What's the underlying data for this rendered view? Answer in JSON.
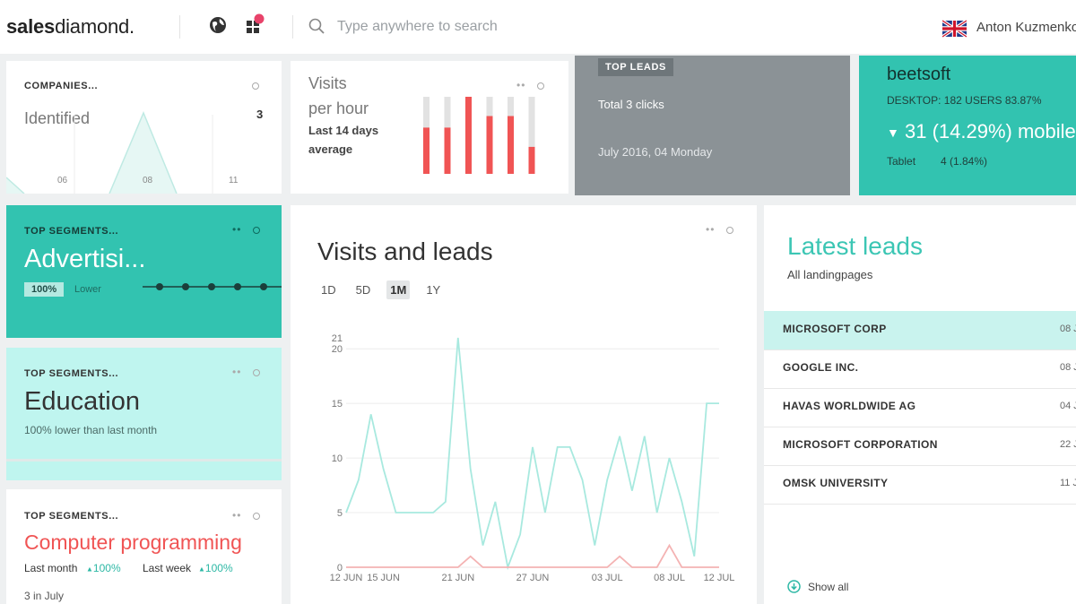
{
  "header": {
    "logo_bold": "sales",
    "logo_regular": "diamond.",
    "search_placeholder": "Type anywhere to search",
    "user_name": "Anton Kuzmenko"
  },
  "companies": {
    "title": "COMPANIES...",
    "label": "Identified",
    "count": "3",
    "ticks": [
      "06",
      "08",
      "11"
    ]
  },
  "visits_per_hour": {
    "title_line1": "Visits",
    "title_line2": "per hour",
    "subtitle_line1": "Last 14 days",
    "subtitle_line2": "average",
    "bars": [
      0.6,
      0.6,
      1.0,
      0.75,
      0.75,
      0.35
    ],
    "bar_color": "#f05454",
    "track_color": "#e2e2e2"
  },
  "top_leads": {
    "badge": "TOP LEADS",
    "clicks": "Total 3 clicks",
    "date": "July 2016, 04 Monday"
  },
  "beetsoft": {
    "name": "beetsoft",
    "desktop": "DESKTOP: 182 USERS 83.87%",
    "mobile": "31 (14.29%) mobile",
    "tablet_label": "Tablet",
    "tablet_value": "4 (1.84%)"
  },
  "segment_advertising": {
    "title": "TOP SEGMENTS...",
    "name": "Advertisi...",
    "badge": "100%",
    "sub": "Lower"
  },
  "segment_education": {
    "title": "TOP SEGMENTS...",
    "name": "Education",
    "sub": "100% lower than last month"
  },
  "segment_programming": {
    "title": "TOP SEGMENTS...",
    "name": "Computer programming",
    "last_month_label": "Last month",
    "last_month_value": "100%",
    "last_week_label": "Last week",
    "last_week_value": "100%",
    "footer": "3 in July"
  },
  "visits_leads": {
    "title": "Visits and leads",
    "timeframes": [
      "1D",
      "5D",
      "1M",
      "1Y"
    ],
    "active_timeframe": "1M"
  },
  "chart_data": {
    "type": "line",
    "y_ticks": [
      0,
      5,
      10,
      15,
      20,
      21
    ],
    "ylim": [
      0,
      21
    ],
    "x_tick_labels": [
      "12 JUN",
      "15 JUN",
      "21 JUN",
      "27 JUN",
      "03 JUL",
      "08 JUL",
      "12 JUL"
    ],
    "x_tick_index": [
      0,
      3,
      9,
      15,
      21,
      26,
      30
    ],
    "x": [
      "12 JUN",
      "13 JUN",
      "14 JUN",
      "15 JUN",
      "16 JUN",
      "17 JUN",
      "18 JUN",
      "19 JUN",
      "20 JUN",
      "21 JUN",
      "22 JUN",
      "23 JUN",
      "24 JUN",
      "25 JUN",
      "26 JUN",
      "27 JUN",
      "28 JUN",
      "29 JUN",
      "30 JUN",
      "01 JUL",
      "02 JUL",
      "03 JUL",
      "04 JUL",
      "05 JUL",
      "06 JUL",
      "07 JUL",
      "08 JUL",
      "09 JUL",
      "10 JUL",
      "11 JUL",
      "12 JUL"
    ],
    "series": [
      {
        "values": [
          5,
          8,
          14,
          9,
          5,
          5,
          5,
          5,
          6,
          21,
          9,
          2,
          6,
          0,
          3,
          11,
          5,
          11,
          11,
          8,
          2,
          8,
          12,
          7,
          12,
          5,
          10,
          6,
          1,
          15,
          15
        ],
        "color": "#a8e9df"
      },
      {
        "values": [
          0,
          0,
          0,
          0,
          0,
          0,
          0,
          0,
          0,
          0,
          1,
          0,
          0,
          0,
          0,
          0,
          0,
          0,
          0,
          0,
          0,
          0,
          1,
          0,
          0,
          0,
          2,
          0,
          0,
          0,
          0
        ],
        "color": "#f4b3b3"
      }
    ],
    "grid": true
  },
  "latest_leads": {
    "title": "Latest leads",
    "subtitle": "All landingpages",
    "rows": [
      {
        "name": "MICROSOFT CORP",
        "date": "08 J"
      },
      {
        "name": "GOOGLE INC.",
        "date": "08 J"
      },
      {
        "name": "HAVAS WORLDWIDE AG",
        "date": "04 J"
      },
      {
        "name": "MICROSOFT CORPORATION",
        "date": "22 J"
      },
      {
        "name": "OMSK UNIVERSITY",
        "date": "11 J"
      }
    ],
    "show_all": "Show all"
  }
}
